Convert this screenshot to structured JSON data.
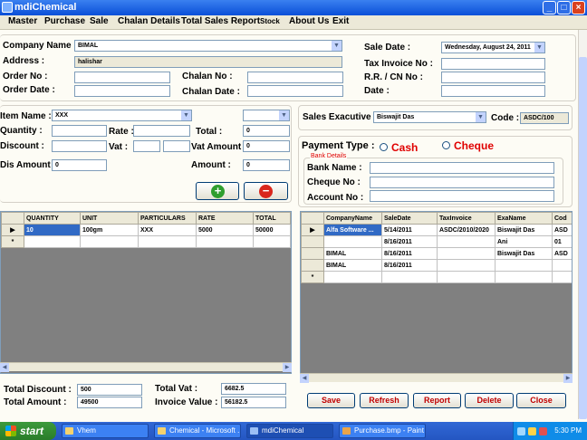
{
  "window": {
    "title": "mdiChemical"
  },
  "menu": [
    "Master",
    "Purchase",
    "Sale",
    "Chalan Details",
    "Total Sales Report",
    "Stock",
    "About Us",
    "Exit"
  ],
  "header": {
    "company_name_label": "Company Name :",
    "company_name_value": "BIMAL",
    "address_label": "Address :",
    "address_value": "halishar",
    "order_no_label": "Order No :",
    "order_date_label": "Order Date :",
    "chalan_no_label": "Chalan No :",
    "chalan_date_label": "Chalan Date :",
    "sale_date_label": "Sale Date :",
    "sale_date_value": "Wednesday,   August   24, 2011",
    "tax_invoice_label": "Tax Invoice No :",
    "rr_cn_label": "R.R. / CN No :",
    "date_label": "Date :"
  },
  "item": {
    "item_name_label": "Item Name :",
    "item_name_value": "XXX",
    "quantity_label": "Quantity :",
    "rate_label": "Rate :",
    "total_label": "Total :",
    "total_value": "0",
    "discount_label": "Discount :",
    "vat_label": "Vat :",
    "vat_amount_label": "Vat Amount :",
    "vat_amount_value": "0",
    "dis_amount_label": "Dis Amount :",
    "dis_amount_value": "0",
    "amount_label": "Amount :",
    "amount_value": "0"
  },
  "sales": {
    "executive_label": "Sales Exacutive :",
    "executive_value": "Biswajit Das",
    "code_label": "Code :",
    "code_value": "ASDC/100",
    "payment_type_label": "Payment Type :",
    "cash_label": "Cash",
    "cheque_label": "Cheque",
    "bank_details_label": "Bank Details",
    "bank_name_label": "Bank Name :",
    "cheque_no_label": "Cheque No :",
    "account_no_label": "Account No :"
  },
  "left_grid": {
    "columns": [
      "QUANTITY",
      "UNIT",
      "PARTICULARS",
      "RATE",
      "TOTAL"
    ],
    "rows": [
      [
        "10",
        "100gm",
        "XXX",
        "5000",
        "50000"
      ]
    ]
  },
  "right_grid": {
    "columns": [
      "CompanyName",
      "SaleDate",
      "TaxInvoice",
      "ExaName",
      "Cod"
    ],
    "rows": [
      [
        "Alfa Software ...",
        "5/14/2011",
        "ASDC/2010/2020",
        "Biswajit Das",
        "ASD"
      ],
      [
        "",
        "8/16/2011",
        "",
        "Ani",
        "01"
      ],
      [
        "BIMAL",
        "8/16/2011",
        "",
        "Biswajit Das",
        "ASD"
      ],
      [
        "BIMAL",
        "8/16/2011",
        "",
        "",
        ""
      ]
    ]
  },
  "totals": {
    "total_discount_label": "Total Discount :",
    "total_discount_value": "500",
    "total_amount_label": "Total Amount :",
    "total_amount_value": "49500",
    "total_vat_label": "Total Vat :",
    "total_vat_value": "6682.5",
    "invoice_value_label": "Invoice Value :",
    "invoice_value_value": "56182.5"
  },
  "buttons": {
    "save": "Save",
    "refresh": "Refresh",
    "report": "Report",
    "delete": "Delete",
    "close": "Close"
  },
  "taskbar": {
    "start": "start",
    "tasks": [
      "Vhem",
      "Chemical - Microsoft ...",
      "mdiChemical",
      "Purchase.bmp - Paint"
    ],
    "clock": "5:30 PM"
  }
}
